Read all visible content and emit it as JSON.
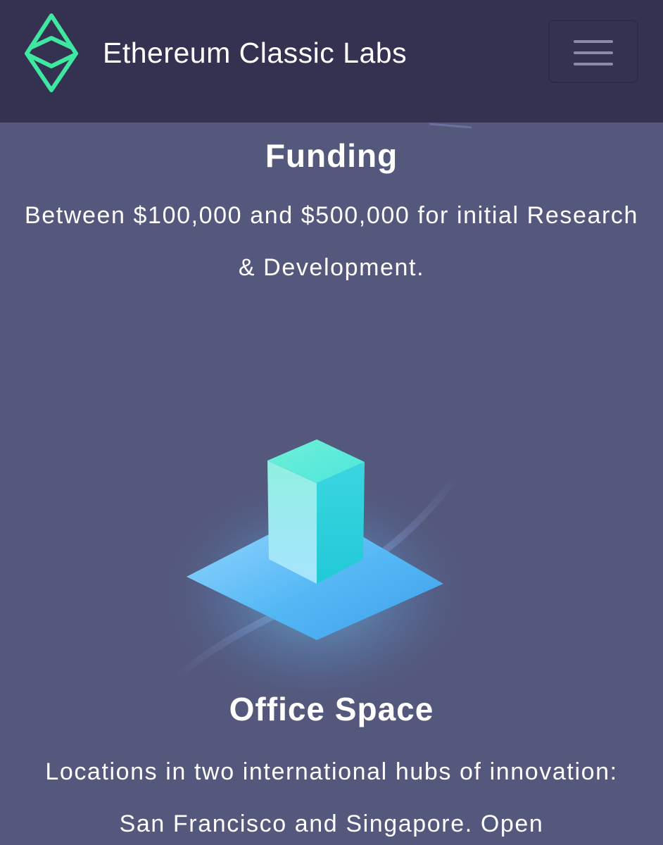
{
  "header": {
    "brand_name": "Ethereum Classic Labs",
    "logo_icon": "ethereum-classic-diamond-icon",
    "menu_icon": "hamburger-menu-icon"
  },
  "sections": {
    "funding": {
      "title": "Funding",
      "body": "Between $100,000 and $500,000 for initial Research & Development."
    },
    "office": {
      "title": "Office Space",
      "body": "Locations in two international hubs of innovation: San Francisco and Singapore. Open",
      "illustration_icon": "isometric-office-block-icon"
    }
  },
  "colors": {
    "navbar_bg": "#353151",
    "page_bg": "#54587c",
    "logo_green": "#3ee8a0",
    "text": "#ffffff",
    "illustration_cyan": "#4fd8e8"
  }
}
